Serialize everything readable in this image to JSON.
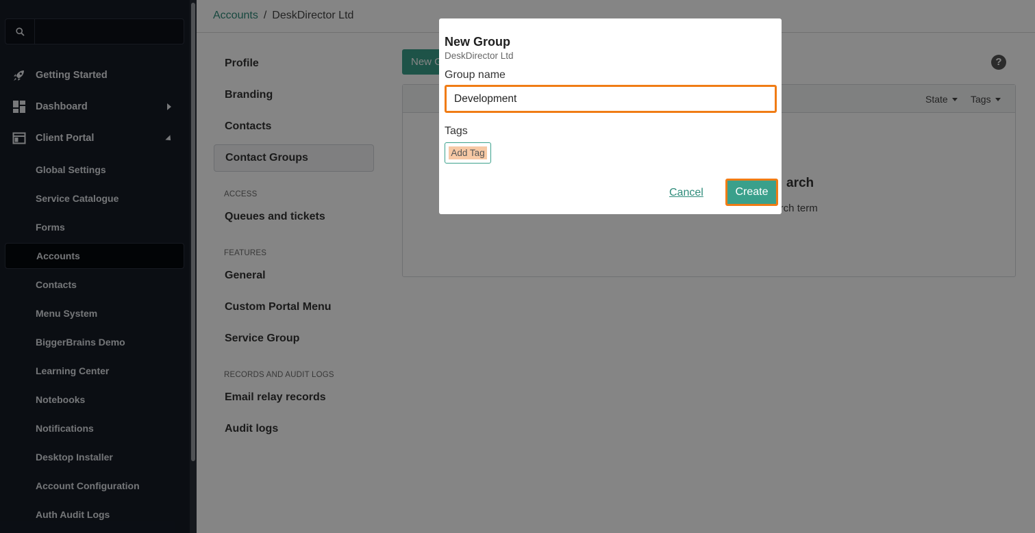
{
  "search": {
    "placeholder": "",
    "value": ""
  },
  "sidebar": {
    "items": [
      {
        "label": "Getting Started",
        "icon": "rocket-icon"
      },
      {
        "label": "Dashboard",
        "icon": "dashboard-icon"
      },
      {
        "label": "Client Portal",
        "icon": "browser-window-icon"
      }
    ],
    "sub_items": [
      "Global Settings",
      "Service Catalogue",
      "Forms",
      "Accounts",
      "Contacts",
      "Menu System",
      "BiggerBrains Demo",
      "Learning Center",
      "Notebooks",
      "Notifications",
      "Desktop Installer",
      "Account Configuration",
      "Auth Audit Logs"
    ],
    "active_sub_item": "Accounts"
  },
  "breadcrumb": {
    "parent": "Accounts",
    "separator": "/",
    "current": "DeskDirector Ltd"
  },
  "subnav": {
    "items": [
      "Profile",
      "Branding",
      "Contacts",
      "Contact Groups"
    ],
    "active": "Contact Groups",
    "access_heading": "ACCESS",
    "access_items": [
      "Queues and tickets"
    ],
    "features_heading": "FEATURES",
    "features_items": [
      "General",
      "Custom Portal Menu",
      "Service Group"
    ],
    "records_heading": "RECORDS AND AUDIT LOGS",
    "records_items": [
      "Email relay records",
      "Audit logs"
    ]
  },
  "content": {
    "new_button": "New Group",
    "help": "?",
    "filters": {
      "state": "State",
      "tags": "Tags"
    },
    "empty_title": "arch",
    "empty_sub": "earch term"
  },
  "modal": {
    "title": "New Group",
    "subtitle": "DeskDirector Ltd",
    "name_label": "Group name",
    "name_value": "Development",
    "tags_label": "Tags",
    "add_tag": "Add Tag",
    "cancel": "Cancel",
    "create": "Create"
  },
  "colors": {
    "accent": "#3aa08b",
    "highlight": "#f07c15",
    "sidebar_bg": "#161b26"
  }
}
